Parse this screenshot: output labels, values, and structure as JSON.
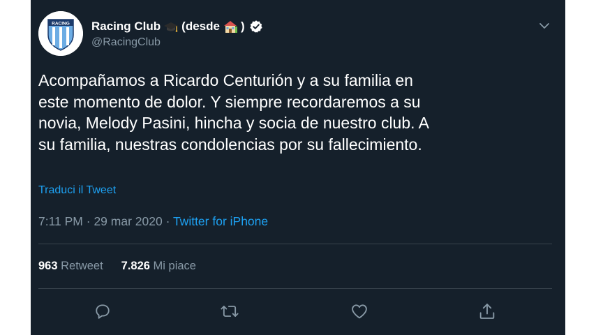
{
  "header": {
    "display_name": "Racing Club",
    "name_suffix_open": "(desde",
    "name_suffix_close": ")",
    "handle": "@RacingClub",
    "avatar_text": "RACING"
  },
  "tweet": {
    "lines": [
      "Acompañamos a Ricardo Centurión y a su familia en",
      "este momento de dolor. Y siempre recordaremos a su",
      "novia, Melody Pasini, hincha y socia de nuestro club. A",
      "su familia, nuestras condolencias por su fallecimiento."
    ],
    "translate_label": "Traduci il Tweet"
  },
  "meta": {
    "time": "7:11 PM",
    "separator": " · ",
    "date": "29 mar 2020",
    "source": "Twitter for iPhone"
  },
  "stats": {
    "retweets_count": "963",
    "retweets_label": "Retweet",
    "likes_count": "7.826",
    "likes_label": "Mi piace"
  },
  "colors": {
    "background": "#15202b",
    "text": "#ffffff",
    "muted": "#8899a6",
    "accent": "#1da1f2",
    "divider": "#38444d"
  },
  "icons": [
    "chevron-down-icon",
    "verified-icon",
    "graduation-cap-emoji",
    "house-emoji",
    "reply-icon",
    "retweet-icon",
    "like-icon",
    "share-icon"
  ]
}
